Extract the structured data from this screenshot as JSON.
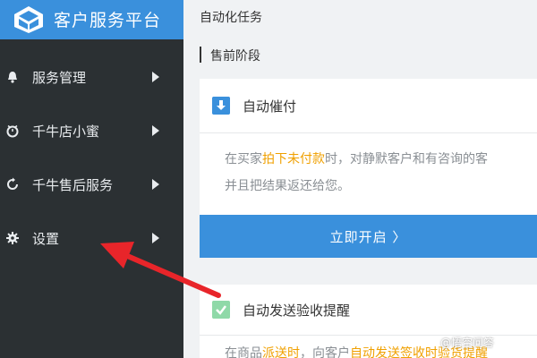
{
  "sidebar": {
    "brand_title": "客户服务平台",
    "items": [
      {
        "label": "服务管理",
        "icon": "bell-icon"
      },
      {
        "label": "千牛店小蜜",
        "icon": "clock-icon"
      },
      {
        "label": "千牛售后服务",
        "icon": "refresh-icon"
      },
      {
        "label": "设置",
        "icon": "gear-icon"
      }
    ]
  },
  "main": {
    "page_title": "自动化任务",
    "section_title": "售前阶段",
    "card1": {
      "title": "自动催付",
      "desc_line1_a": "在买家",
      "desc_line1_hl": "拍下未付款",
      "desc_line1_b": "时，对静默客户和有咨询的客",
      "desc_line2": "并且把结果返还给您。",
      "button_label": "立即开启 〉"
    },
    "card2": {
      "title": "自动发送验收提醒",
      "desc_a": "在商品",
      "desc_hl1": "派送时",
      "desc_b": "，向客户",
      "desc_hl2": "自动发送签收时验货提醒"
    }
  },
  "watermark": "@悟空问答",
  "colors": {
    "sidebar_bg": "#2b3033",
    "brand_bg": "#3a90dc",
    "accent": "#3a90dc",
    "highlight": "#f0a000",
    "annotation_arrow": "#e8252a"
  }
}
